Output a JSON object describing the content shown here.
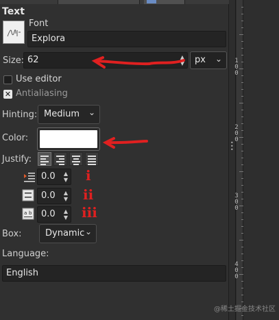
{
  "panel": {
    "title": "Text",
    "font_label": "Font",
    "font_value": "Explora",
    "size_label": "Size:",
    "size_value": "62",
    "size_unit": "px",
    "use_editor_label": "Use editor",
    "use_editor_checked": false,
    "antialiasing_label": "Antialiasing",
    "antialiasing_checked": true,
    "hinting_label": "Hinting:",
    "hinting_value": "Medium",
    "color_label": "Color:",
    "color_value": "#ffffff",
    "justify_label": "Justify:",
    "indent_value": "0.0",
    "line_spacing_value": "0.0",
    "letter_spacing_value": "0.0",
    "box_label": "Box:",
    "box_value": "Dynamic",
    "language_label": "Language:",
    "language_value": "English"
  },
  "annotations": {
    "numeral_1": "i",
    "numeral_2": "ii",
    "numeral_3": "iii",
    "color": "#e02020"
  },
  "ruler": {
    "marks": [
      "100",
      "200",
      "300",
      "400"
    ]
  },
  "watermark": "@稀土掘金技术社区"
}
